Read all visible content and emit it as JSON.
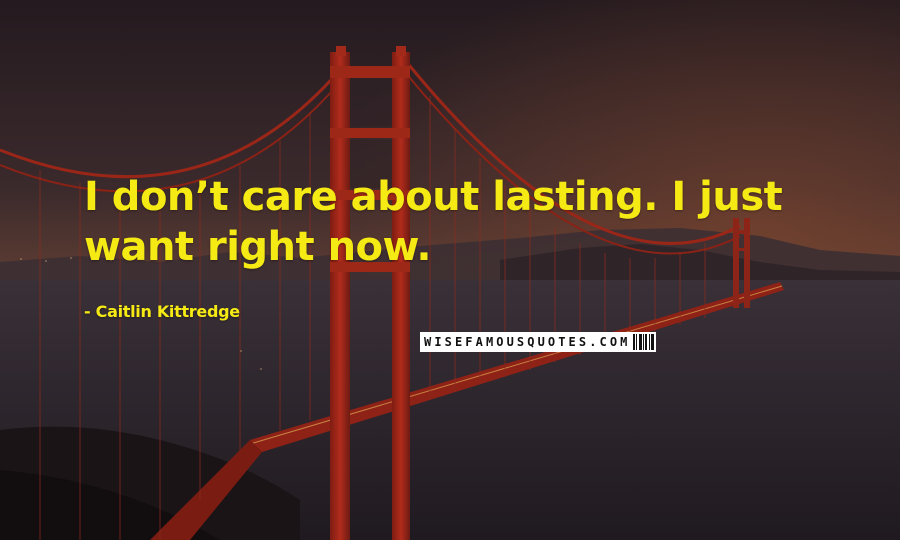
{
  "quote": {
    "text": "I don’t care about lasting. I just want right now.",
    "author": "Caitlin Kittredge"
  },
  "watermark": {
    "text": "WISEFAMOUSQUOTES.COM"
  },
  "colors": {
    "quote_text": "#f5ea14",
    "bridge": "#a3271a",
    "sky_top": "#2a1d22",
    "water": "#2e2730"
  }
}
